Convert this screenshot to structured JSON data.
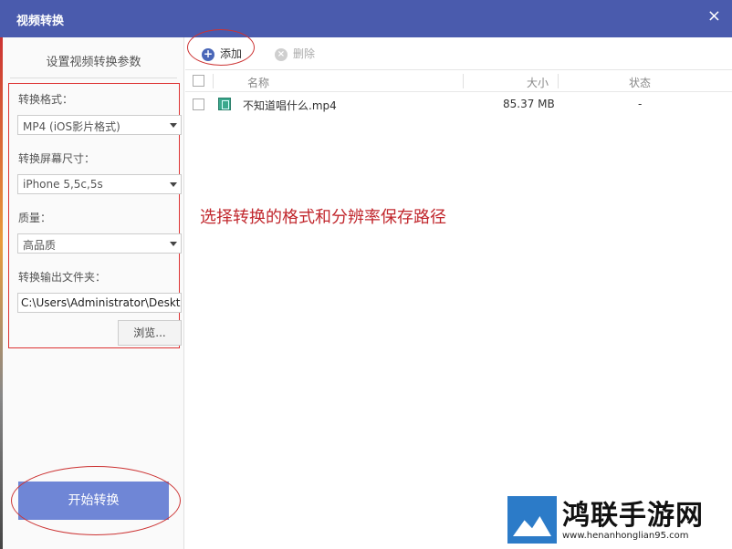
{
  "window": {
    "title": "视频转换",
    "close_symbol": "×"
  },
  "sidebar": {
    "title": "设置视频转换参数",
    "format_label": "转换格式：",
    "format_value": "MP4 (iOS影片格式)",
    "size_label": "转换屏幕尺寸：",
    "size_value": "iPhone 5,5c,5s",
    "quality_label": "质量：",
    "quality_value": "高品质",
    "output_label": "转换输出文件夹：",
    "output_value": "C:\\Users\\Administrator\\Desktop",
    "browse_label": "浏览...",
    "start_label": "开始转换"
  },
  "toolbar": {
    "add_label": "添加",
    "add_icon": "plus-circle-icon",
    "delete_label": "删除",
    "delete_icon": "x-circle-icon"
  },
  "table": {
    "headers": {
      "name": "名称",
      "size": "大小",
      "status": "状态"
    },
    "rows": [
      {
        "name": "不知道唱什么.mp4",
        "size": "85.37 MB",
        "status": "-"
      }
    ]
  },
  "annotation": "选择转换的格式和分辨率保存路径",
  "watermark": {
    "text": "鸿联手游网",
    "url": "www.henanhonglian95.com"
  },
  "colors": {
    "titlebar": "#4a5bad",
    "start_button": "#6f86d6",
    "annotation": "#c1272d"
  }
}
